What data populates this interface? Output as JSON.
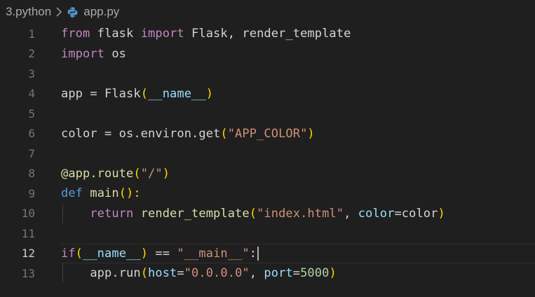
{
  "breadcrumb": {
    "folder": "3.python",
    "file": "app.py"
  },
  "icons": {
    "separator": "chevron-right-icon",
    "file": "python-file-icon"
  },
  "editor": {
    "active_line": "12",
    "lines": [
      {
        "number": "1",
        "t": [
          "from",
          " flask ",
          "import",
          " Flask, render_template"
        ]
      },
      {
        "number": "2",
        "t": [
          "import",
          " os"
        ]
      },
      {
        "number": "3",
        "t": []
      },
      {
        "number": "4",
        "t": [
          "app = Flask",
          "(",
          "__name__",
          ")"
        ]
      },
      {
        "number": "5",
        "t": []
      },
      {
        "number": "6",
        "t": [
          "color = os.environ.get",
          "(",
          "\"APP_COLOR\"",
          ")"
        ]
      },
      {
        "number": "7",
        "t": []
      },
      {
        "number": "8",
        "t": [
          "@app.route",
          "(",
          "\"/\"",
          ")"
        ]
      },
      {
        "number": "9",
        "t": [
          "def",
          " ",
          "main",
          "():"
        ]
      },
      {
        "number": "10",
        "t": [
          "    ",
          "return",
          " ",
          "render_template",
          "(",
          "\"index.html\"",
          ", ",
          "color",
          "=color",
          ")"
        ]
      },
      {
        "number": "11",
        "t": []
      },
      {
        "number": "12",
        "t": [
          "if",
          "(",
          "__name__",
          ")",
          " == ",
          "\"__main__\"",
          ":"
        ]
      },
      {
        "number": "13",
        "t": [
          "    app.run",
          "(",
          "host",
          "=",
          "\"0.0.0.0\"",
          ", ",
          "port",
          "=",
          "5000",
          ")"
        ]
      }
    ]
  },
  "colors": {
    "background": "#1f1f1f",
    "keyword_control": "#c586c0",
    "keyword": "#569cd6",
    "function": "#dcdcaa",
    "string": "#ce9178",
    "variable": "#9cdcfe",
    "number": "#b5cea8",
    "bracket_level1": "#ffd700",
    "bracket_level2": "#da70d6",
    "line_number": "#6e7681",
    "line_number_active": "#cccccc"
  }
}
